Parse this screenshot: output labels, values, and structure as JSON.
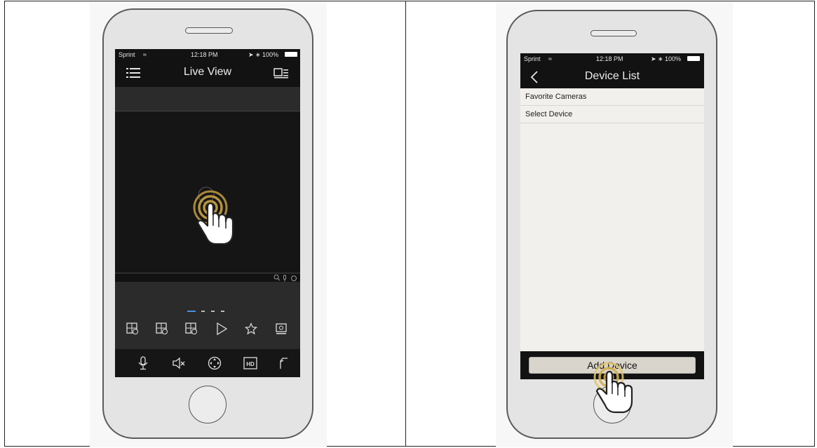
{
  "colors": {
    "gold": "#b8943d",
    "screen_dark": "#121212",
    "list_bg": "#f2f0ec",
    "button_bg": "#d9d5cc"
  },
  "left_phone": {
    "status": {
      "carrier": "Sprint",
      "time": "12:18 PM",
      "battery": "100%"
    },
    "title": "Live View",
    "menu_icon": "menu-list-icon",
    "device_list_icon": "device-list-icon",
    "video_overlay_icons": [
      "zoom-icon",
      "mic-icon",
      "circle-icon"
    ],
    "toolbar_icons": [
      "layout-grid-icon",
      "layout-grid-icon",
      "layout-grid-icon",
      "play-icon",
      "star-icon",
      "screen-icon"
    ],
    "bottom_icons": [
      "microphone-icon",
      "speaker-mute-icon",
      "ptz-control-icon",
      "hd-icon",
      "more-icon"
    ],
    "hd_label": "HD"
  },
  "right_phone": {
    "status": {
      "carrier": "Sprint",
      "time": "12:18 PM",
      "battery": "100%"
    },
    "title": "Device List",
    "back_icon": "back-chevron-icon",
    "rows": [
      "Favorite Cameras",
      "Select Device"
    ],
    "add_button": "Add Device"
  }
}
